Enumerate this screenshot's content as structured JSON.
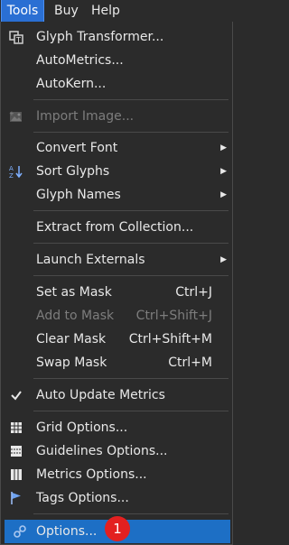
{
  "menubar": {
    "tools": "Tools",
    "buy": "Buy",
    "help": "Help"
  },
  "menu": {
    "glyph_transformer": "Glyph Transformer...",
    "automatics": "AutoMetrics...",
    "autokern": "AutoKern...",
    "import_image": "Import Image...",
    "convert_font": "Convert Font",
    "sort_glyphs": "Sort Glyphs",
    "glyph_names": "Glyph Names",
    "extract_from_collection": "Extract from Collection...",
    "launch_externals": "Launch Externals",
    "set_as_mask": "Set as Mask",
    "set_as_mask_sc": "Ctrl+J",
    "add_to_mask": "Add to Mask",
    "add_to_mask_sc": "Ctrl+Shift+J",
    "clear_mask": "Clear Mask",
    "clear_mask_sc": "Ctrl+Shift+M",
    "swap_mask": "Swap Mask",
    "swap_mask_sc": "Ctrl+M",
    "auto_update_metrics": "Auto Update Metrics",
    "grid_options": "Grid Options...",
    "guidelines_options": "Guidelines Options...",
    "metrics_options": "Metrics Options...",
    "tags_options": "Tags Options...",
    "options": "Options..."
  },
  "badge": "1",
  "colors": {
    "accent": "#1d6fc5",
    "badge": "#e32020",
    "background": "#2b2b2b"
  }
}
